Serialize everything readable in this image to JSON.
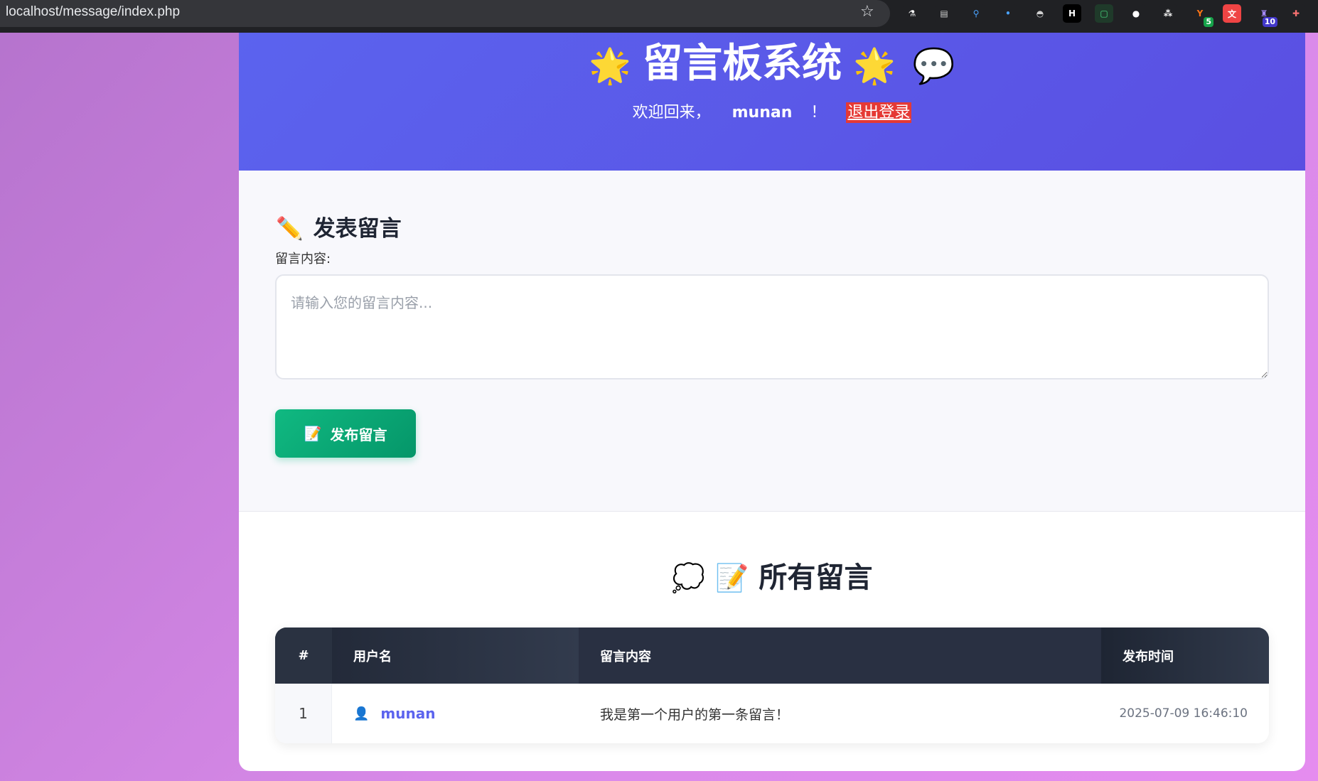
{
  "browser": {
    "url": "localhost/message/index.php",
    "extensions": [
      {
        "name": "flask-icon",
        "glyph": "⚗",
        "color": "#ffffff",
        "bg": "#202124"
      },
      {
        "name": "window-icon",
        "glyph": "▤",
        "color": "#d0d0d0",
        "bg": "#202124"
      },
      {
        "name": "pin-icon",
        "glyph": "⚲",
        "color": "#4aa3ff",
        "bg": "#202124"
      },
      {
        "name": "bird-icon",
        "glyph": "•",
        "color": "#4aa3ff",
        "bg": "#202124"
      },
      {
        "name": "hat-icon",
        "glyph": "◓",
        "color": "#d0d0d0",
        "bg": "#202124"
      },
      {
        "name": "h-icon",
        "glyph": "H",
        "color": "#ffffff",
        "bg": "#000000"
      },
      {
        "name": "square-icon",
        "glyph": "▢",
        "color": "#4ade80",
        "bg": "#1f3a2a"
      },
      {
        "name": "circle-icon",
        "glyph": "●",
        "color": "#ffffff",
        "bg": "#202124"
      },
      {
        "name": "dots-icon",
        "glyph": "⁂",
        "color": "#ffffff",
        "bg": "#202124"
      },
      {
        "name": "fox-icon",
        "glyph": "Y",
        "color": "#f97316",
        "bg": "#202124",
        "badge": "5",
        "badge_bg": "#16a34a"
      },
      {
        "name": "translate-icon",
        "glyph": "文",
        "color": "#ffffff",
        "bg": "#ef4444"
      },
      {
        "name": "wizard-icon",
        "glyph": "♜",
        "color": "#a78bfa",
        "bg": "#202124",
        "badge": "10",
        "badge_bg": "#4338ca"
      },
      {
        "name": "puzzle-icon",
        "glyph": "✚",
        "color": "#f87171",
        "bg": "#202124"
      }
    ]
  },
  "header": {
    "title": "留言板系统",
    "title_icon_left": "🌟",
    "title_icon_right": "🌟",
    "title_icon_bubble": "💬",
    "welcome_prefix": "欢迎回来，",
    "username": "munan",
    "welcome_suffix": "！",
    "logout_label": "退出登录"
  },
  "post_form": {
    "title": "发表留言",
    "title_icon": "✏️",
    "content_label": "留言内容:",
    "content_placeholder": "请输入您的留言内容...",
    "content_value": "",
    "submit_icon": "📝",
    "submit_label": "发布留言"
  },
  "messages": {
    "title": "所有留言",
    "title_icon_cloud": "💭",
    "title_icon_memo": "📝",
    "columns": {
      "num": "#",
      "username": "用户名",
      "content": "留言内容",
      "time": "发布时间"
    },
    "rows": [
      {
        "num": "1",
        "user_icon": "👤",
        "username": "munan",
        "content": "我是第一个用户的第一条留言！",
        "time": "2025-07-09 16:46:10"
      }
    ]
  }
}
